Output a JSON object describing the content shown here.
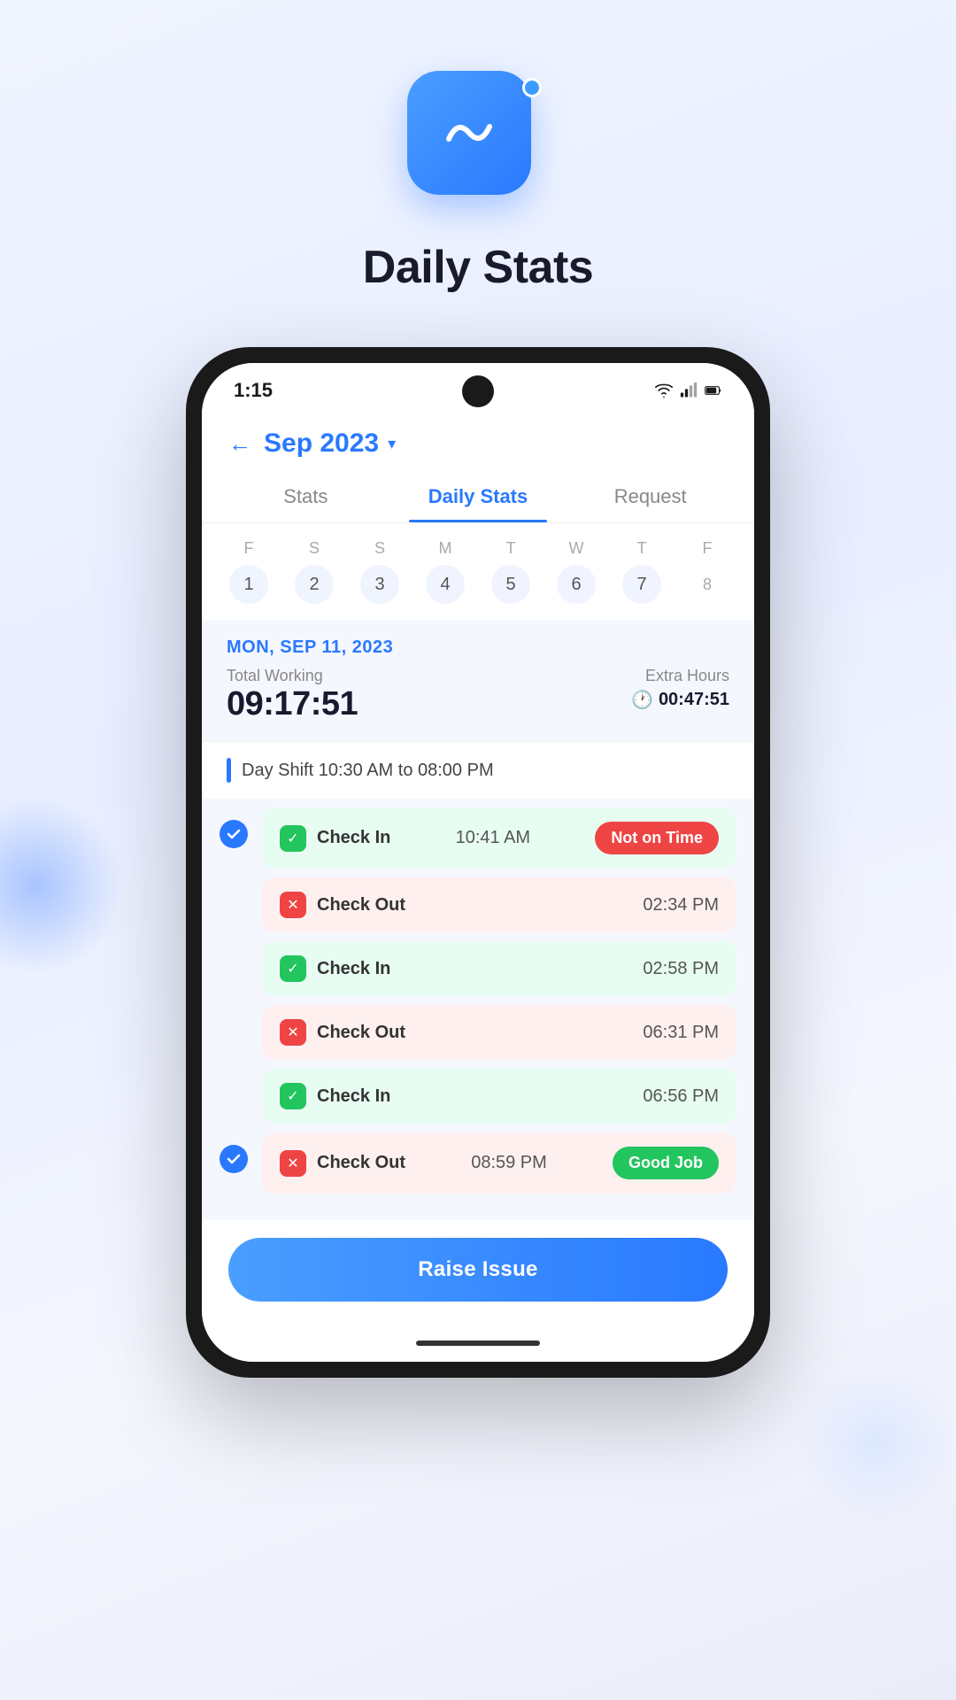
{
  "app": {
    "title": "Daily Stats"
  },
  "status_bar": {
    "time": "1:15"
  },
  "header": {
    "month": "Sep 2023",
    "back_label": "←"
  },
  "tabs": [
    {
      "label": "Stats",
      "active": false
    },
    {
      "label": "Daily Stats",
      "active": true
    },
    {
      "label": "Request",
      "active": false
    }
  ],
  "calendar": {
    "days": [
      {
        "name": "F",
        "num": "1"
      },
      {
        "name": "S",
        "num": "2"
      },
      {
        "name": "S",
        "num": "3"
      },
      {
        "name": "M",
        "num": "4"
      },
      {
        "name": "T",
        "num": "5"
      },
      {
        "name": "W",
        "num": "6"
      },
      {
        "name": "T",
        "num": "7"
      },
      {
        "name": "F",
        "num": "8"
      }
    ]
  },
  "daily": {
    "date": "MON, SEP 11, 2023",
    "total_working_label": "Total Working",
    "total_working_time": "09:17:51",
    "extra_hours_label": "Extra Hours",
    "extra_hours_time": "00:47:51"
  },
  "shift": {
    "label": "Day Shift  10:30 AM to 08:00 PM"
  },
  "entries": [
    {
      "type": "checkin",
      "label": "Check In",
      "time": "10:41 AM",
      "badge": "Not on Time",
      "badge_type": "not-on-time",
      "has_circle": true
    },
    {
      "type": "checkout",
      "label": "Check Out",
      "time": "02:34 PM",
      "badge": null,
      "has_circle": false
    },
    {
      "type": "checkin",
      "label": "Check In",
      "time": "02:58 PM",
      "badge": null,
      "has_circle": false
    },
    {
      "type": "checkout",
      "label": "Check Out",
      "time": "06:31 PM",
      "badge": null,
      "has_circle": false
    },
    {
      "type": "checkin",
      "label": "Check In",
      "time": "06:56 PM",
      "badge": null,
      "has_circle": false
    },
    {
      "type": "checkout",
      "label": "Check Out",
      "time": "08:59 PM",
      "badge": "Good Job",
      "badge_type": "good-job",
      "has_circle": true
    }
  ],
  "raise_issue": {
    "label": "Raise Issue"
  }
}
